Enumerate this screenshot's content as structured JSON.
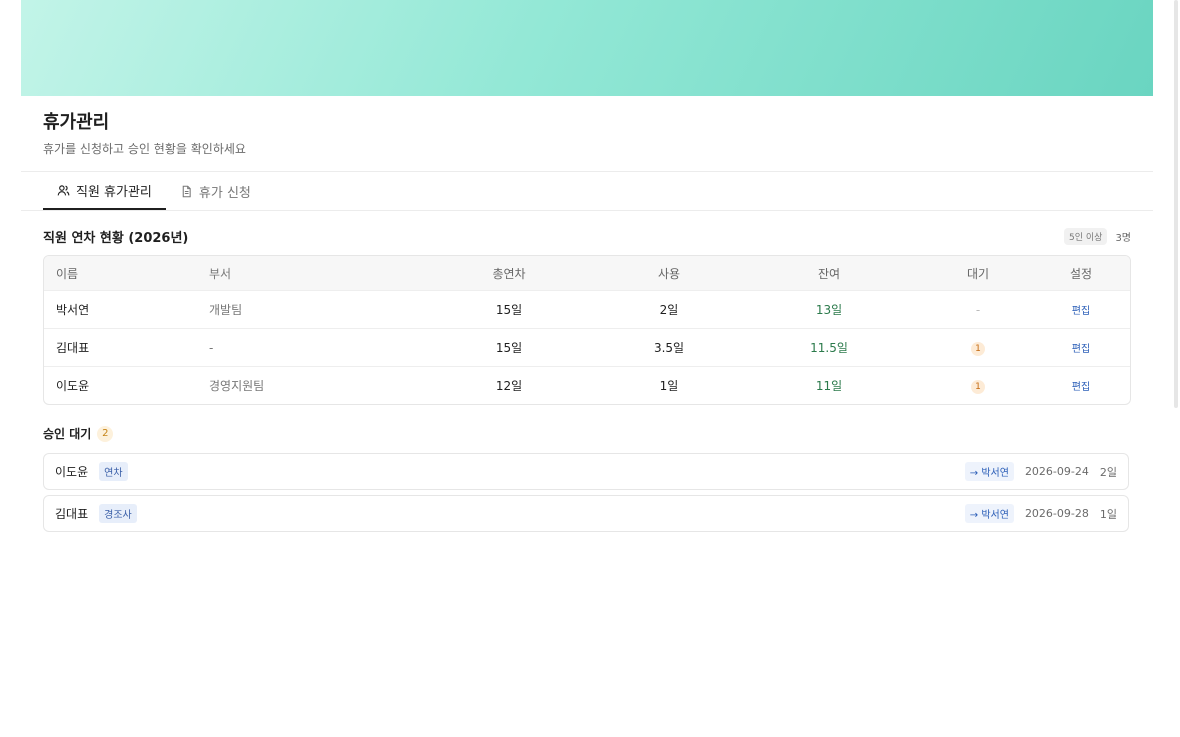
{
  "header": {
    "title": "휴가관리",
    "subtitle": "휴가를 신청하고 승인 현황을 확인하세요"
  },
  "tabs": [
    {
      "label": "직원 휴가관리",
      "icon": "users-icon",
      "active": true
    },
    {
      "label": "휴가 신청",
      "icon": "document-icon",
      "active": false
    }
  ],
  "status": {
    "title": "직원 연차 현황 (2026년)",
    "badge": "5인 이상",
    "count": "3명",
    "columns": [
      "이름",
      "부서",
      "총연차",
      "사용",
      "잔여",
      "대기",
      "설정"
    ],
    "rows": [
      {
        "name": "박서연",
        "dept": "개발팀",
        "total": "15일",
        "used": "2일",
        "remain": "13일",
        "pending": "-",
        "action": "편집"
      },
      {
        "name": "김대표",
        "dept": "-",
        "total": "15일",
        "used": "3.5일",
        "remain": "11.5일",
        "pending": "1",
        "action": "편집"
      },
      {
        "name": "이도윤",
        "dept": "경영지원팀",
        "total": "12일",
        "used": "1일",
        "remain": "11일",
        "pending": "1",
        "action": "편집"
      }
    ]
  },
  "pending": {
    "title": "승인 대기",
    "count": "2",
    "items": [
      {
        "name": "이도윤",
        "type": "연차",
        "approver": "→ 박서연",
        "date": "2026-09-24",
        "days": "2일"
      },
      {
        "name": "김대표",
        "type": "경조사",
        "approver": "→ 박서연",
        "date": "2026-09-28",
        "days": "1일"
      }
    ]
  },
  "colors": {
    "banner_start": "#c2f4e8",
    "banner_end": "#6ad5c1",
    "remain_text": "#2b7a4b",
    "link": "#2c5fb8",
    "pending_badge": "#fdebd6"
  }
}
